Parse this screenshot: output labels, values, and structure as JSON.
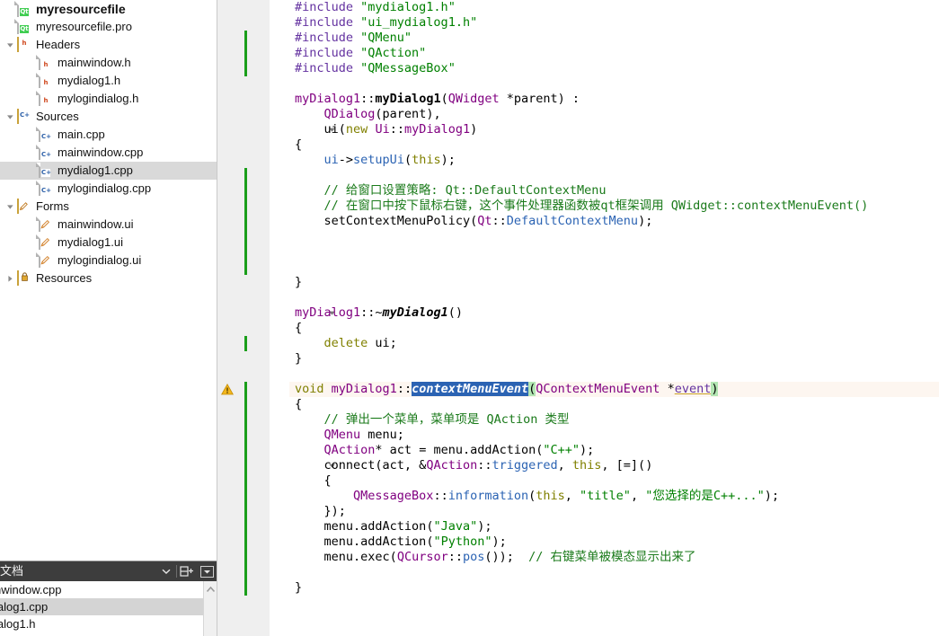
{
  "sidebar": {
    "tree": [
      {
        "depth": 0,
        "label": "myresourcefile",
        "icon": "qt-project-icon",
        "type": "project",
        "twisty": "none",
        "selected": false
      },
      {
        "depth": 1,
        "label": "myresourcefile.pro",
        "icon": "qt-pro-file-icon",
        "type": "profile",
        "twisty": "none",
        "selected": false
      },
      {
        "depth": 1,
        "label": "Headers",
        "icon": "headers-folder-icon",
        "type": "folder-h",
        "twisty": "expanded",
        "selected": false
      },
      {
        "depth": 2,
        "label": "mainwindow.h",
        "icon": "header-file-icon",
        "type": "file-h",
        "twisty": "none",
        "selected": false
      },
      {
        "depth": 2,
        "label": "mydialog1.h",
        "icon": "header-file-icon",
        "type": "file-h",
        "twisty": "none",
        "selected": false
      },
      {
        "depth": 2,
        "label": "mylogindialog.h",
        "icon": "header-file-icon",
        "type": "file-h",
        "twisty": "none",
        "selected": false
      },
      {
        "depth": 1,
        "label": "Sources",
        "icon": "sources-folder-icon",
        "type": "folder-cpp",
        "twisty": "expanded",
        "selected": false
      },
      {
        "depth": 2,
        "label": "main.cpp",
        "icon": "cpp-file-icon",
        "type": "file-cpp",
        "twisty": "none",
        "selected": false
      },
      {
        "depth": 2,
        "label": "mainwindow.cpp",
        "icon": "cpp-file-icon",
        "type": "file-cpp",
        "twisty": "none",
        "selected": false
      },
      {
        "depth": 2,
        "label": "mydialog1.cpp",
        "icon": "cpp-file-icon",
        "type": "file-cpp",
        "twisty": "none",
        "selected": true
      },
      {
        "depth": 2,
        "label": "mylogindialog.cpp",
        "icon": "cpp-file-icon",
        "type": "file-cpp",
        "twisty": "none",
        "selected": false
      },
      {
        "depth": 1,
        "label": "Forms",
        "icon": "forms-folder-icon",
        "type": "folder-ui",
        "twisty": "expanded",
        "selected": false
      },
      {
        "depth": 2,
        "label": "mainwindow.ui",
        "icon": "ui-file-icon",
        "type": "file-ui",
        "twisty": "none",
        "selected": false
      },
      {
        "depth": 2,
        "label": "mydialog1.ui",
        "icon": "ui-file-icon",
        "type": "file-ui",
        "twisty": "none",
        "selected": false
      },
      {
        "depth": 2,
        "label": "mylogindialog.ui",
        "icon": "ui-file-icon",
        "type": "file-ui",
        "twisty": "none",
        "selected": false
      },
      {
        "depth": 1,
        "label": "Resources",
        "icon": "resources-folder-icon",
        "type": "folder-res",
        "twisty": "collapsed",
        "selected": false
      }
    ]
  },
  "doc_dock": {
    "title": "文档",
    "dropdown_icon": "chevron-down-icon",
    "split_icon": "split-pane-icon",
    "close_icon": "dock-menu-icon",
    "items": [
      {
        "label": "nwindow.cpp",
        "selected": false
      },
      {
        "label": "ialog1.cpp",
        "selected": true
      },
      {
        "label": "ialog1.h",
        "selected": false
      }
    ],
    "scroll_up_icon": "scroll-up-icon"
  },
  "editor": {
    "current_line": 26,
    "warning_line": 26,
    "warning_icon": "warning-triangle-icon",
    "total_lines": 40,
    "change_bars": [
      {
        "from": 3,
        "to": 5
      },
      {
        "from": 12,
        "to": 18
      },
      {
        "from": 23,
        "to": 23
      },
      {
        "from": 26,
        "to": 39
      }
    ],
    "fold_markers": [
      9,
      21,
      26,
      31
    ],
    "lines": [
      {
        "n": 1,
        "tokens": [
          {
            "t": "#include ",
            "c": "t-pre"
          },
          {
            "t": "\"mydialog1.h\"",
            "c": "t-str"
          }
        ]
      },
      {
        "n": 2,
        "tokens": [
          {
            "t": "#include ",
            "c": "t-pre"
          },
          {
            "t": "\"ui_mydialog1.h\"",
            "c": "t-str"
          }
        ]
      },
      {
        "n": 3,
        "tokens": [
          {
            "t": "#include ",
            "c": "t-pre"
          },
          {
            "t": "\"QMenu\"",
            "c": "t-str"
          }
        ]
      },
      {
        "n": 4,
        "tokens": [
          {
            "t": "#include ",
            "c": "t-pre"
          },
          {
            "t": "\"QAction\"",
            "c": "t-str"
          }
        ]
      },
      {
        "n": 5,
        "tokens": [
          {
            "t": "#include ",
            "c": "t-pre"
          },
          {
            "t": "\"QMessageBox\"",
            "c": "t-str"
          }
        ]
      },
      {
        "n": 6,
        "tokens": []
      },
      {
        "n": 7,
        "tokens": [
          {
            "t": "myDialog1",
            "c": "t-type"
          },
          {
            "t": "::",
            "c": "t-plain"
          },
          {
            "t": "myDialog1",
            "c": "t-ctor"
          },
          {
            "t": "(",
            "c": "t-plain"
          },
          {
            "t": "QWidget",
            "c": "t-type"
          },
          {
            "t": " *parent) :",
            "c": "t-plain"
          }
        ]
      },
      {
        "n": 8,
        "tokens": [
          {
            "t": "    ",
            "c": "t-plain"
          },
          {
            "t": "QDialog",
            "c": "t-type"
          },
          {
            "t": "(parent),",
            "c": "t-plain"
          }
        ]
      },
      {
        "n": 9,
        "tokens": [
          {
            "t": "    ui(",
            "c": "t-plain"
          },
          {
            "t": "new",
            "c": "t-kw"
          },
          {
            "t": " ",
            "c": "t-plain"
          },
          {
            "t": "Ui",
            "c": "t-type"
          },
          {
            "t": "::",
            "c": "t-plain"
          },
          {
            "t": "myDialog1",
            "c": "t-type"
          },
          {
            "t": ")",
            "c": "t-plain"
          }
        ]
      },
      {
        "n": 10,
        "tokens": [
          {
            "t": "{",
            "c": "t-plain"
          }
        ]
      },
      {
        "n": 11,
        "tokens": [
          {
            "t": "    ",
            "c": "t-plain"
          },
          {
            "t": "ui",
            "c": "t-blue"
          },
          {
            "t": "->",
            "c": "t-plain"
          },
          {
            "t": "setupUi",
            "c": "t-blue"
          },
          {
            "t": "(",
            "c": "t-plain"
          },
          {
            "t": "this",
            "c": "t-kw"
          },
          {
            "t": ");",
            "c": "t-plain"
          }
        ]
      },
      {
        "n": 12,
        "tokens": []
      },
      {
        "n": 13,
        "tokens": [
          {
            "t": "    // 给窗口设置策略: Qt::DefaultContextMenu",
            "c": "t-cmt"
          }
        ]
      },
      {
        "n": 14,
        "tokens": [
          {
            "t": "    // 在窗口中按下鼠标右键，这个事件处理器函数被qt框架调用 QWidget::contextMenuEvent()",
            "c": "t-cmt"
          }
        ]
      },
      {
        "n": 15,
        "tokens": [
          {
            "t": "    ",
            "c": "t-plain"
          },
          {
            "t": "setContextMenuPolicy",
            "c": "t-plain"
          },
          {
            "t": "(",
            "c": "t-plain"
          },
          {
            "t": "Qt",
            "c": "t-type"
          },
          {
            "t": "::",
            "c": "t-plain"
          },
          {
            "t": "DefaultContextMenu",
            "c": "t-blue"
          },
          {
            "t": ");",
            "c": "t-plain"
          }
        ]
      },
      {
        "n": 16,
        "tokens": []
      },
      {
        "n": 17,
        "tokens": []
      },
      {
        "n": 18,
        "tokens": []
      },
      {
        "n": 19,
        "tokens": [
          {
            "t": "}",
            "c": "t-plain"
          }
        ]
      },
      {
        "n": 20,
        "tokens": []
      },
      {
        "n": 21,
        "tokens": [
          {
            "t": "myDialog1",
            "c": "t-type"
          },
          {
            "t": "::~",
            "c": "t-plain"
          },
          {
            "t": "myDialog1",
            "c": "t-dtor"
          },
          {
            "t": "()",
            "c": "t-plain"
          }
        ]
      },
      {
        "n": 22,
        "tokens": [
          {
            "t": "{",
            "c": "t-plain"
          }
        ]
      },
      {
        "n": 23,
        "tokens": [
          {
            "t": "    ",
            "c": "t-plain"
          },
          {
            "t": "delete",
            "c": "t-kw"
          },
          {
            "t": " ui;",
            "c": "t-plain"
          }
        ]
      },
      {
        "n": 24,
        "tokens": [
          {
            "t": "}",
            "c": "t-plain"
          }
        ]
      },
      {
        "n": 25,
        "tokens": []
      },
      {
        "n": 26,
        "tokens": [
          {
            "t": "void",
            "c": "t-kw"
          },
          {
            "t": " ",
            "c": "t-plain"
          },
          {
            "t": "myDialog1",
            "c": "t-type"
          },
          {
            "t": "::",
            "c": "t-plain"
          },
          {
            "t": "contextMenuEvent",
            "c": "sel"
          },
          {
            "t": "(",
            "c": "brmatch"
          },
          {
            "t": "QContextMenuEvent",
            "c": "t-type"
          },
          {
            "t": " *",
            "c": "t-plain"
          },
          {
            "t": "event",
            "c": "t-param"
          },
          {
            "t": ")",
            "c": "brmatch"
          }
        ]
      },
      {
        "n": 27,
        "tokens": [
          {
            "t": "{",
            "c": "t-plain"
          }
        ]
      },
      {
        "n": 28,
        "tokens": [
          {
            "t": "    // 弹出一个菜单，菜单项是 QAction 类型",
            "c": "t-cmt"
          }
        ]
      },
      {
        "n": 29,
        "tokens": [
          {
            "t": "    ",
            "c": "t-plain"
          },
          {
            "t": "QMenu",
            "c": "t-type"
          },
          {
            "t": " menu;",
            "c": "t-plain"
          }
        ]
      },
      {
        "n": 30,
        "tokens": [
          {
            "t": "    ",
            "c": "t-plain"
          },
          {
            "t": "QAction",
            "c": "t-type"
          },
          {
            "t": "* act = menu.",
            "c": "t-plain"
          },
          {
            "t": "addAction",
            "c": "t-plain"
          },
          {
            "t": "(",
            "c": "t-plain"
          },
          {
            "t": "\"C++\"",
            "c": "t-str"
          },
          {
            "t": ");",
            "c": "t-plain"
          }
        ]
      },
      {
        "n": 31,
        "tokens": [
          {
            "t": "    connect(act, &",
            "c": "t-plain"
          },
          {
            "t": "QAction",
            "c": "t-type"
          },
          {
            "t": "::",
            "c": "t-plain"
          },
          {
            "t": "triggered",
            "c": "t-blue"
          },
          {
            "t": ", ",
            "c": "t-plain"
          },
          {
            "t": "this",
            "c": "t-kw"
          },
          {
            "t": ", [=]()",
            "c": "t-plain"
          }
        ]
      },
      {
        "n": 32,
        "tokens": [
          {
            "t": "    {",
            "c": "t-plain"
          }
        ]
      },
      {
        "n": 33,
        "tokens": [
          {
            "t": "        ",
            "c": "t-plain"
          },
          {
            "t": "QMessageBox",
            "c": "t-type"
          },
          {
            "t": "::",
            "c": "t-plain"
          },
          {
            "t": "information",
            "c": "t-blue"
          },
          {
            "t": "(",
            "c": "t-plain"
          },
          {
            "t": "this",
            "c": "t-kw"
          },
          {
            "t": ", ",
            "c": "t-plain"
          },
          {
            "t": "\"title\"",
            "c": "t-str"
          },
          {
            "t": ", ",
            "c": "t-plain"
          },
          {
            "t": "\"您选择的是C++...\"",
            "c": "t-str"
          },
          {
            "t": ");",
            "c": "t-plain"
          }
        ]
      },
      {
        "n": 34,
        "tokens": [
          {
            "t": "    });",
            "c": "t-plain"
          }
        ]
      },
      {
        "n": 35,
        "tokens": [
          {
            "t": "    menu.",
            "c": "t-plain"
          },
          {
            "t": "addAction",
            "c": "t-plain"
          },
          {
            "t": "(",
            "c": "t-plain"
          },
          {
            "t": "\"Java\"",
            "c": "t-str"
          },
          {
            "t": ");",
            "c": "t-plain"
          }
        ]
      },
      {
        "n": 36,
        "tokens": [
          {
            "t": "    menu.",
            "c": "t-plain"
          },
          {
            "t": "addAction",
            "c": "t-plain"
          },
          {
            "t": "(",
            "c": "t-plain"
          },
          {
            "t": "\"Python\"",
            "c": "t-str"
          },
          {
            "t": ");",
            "c": "t-plain"
          }
        ]
      },
      {
        "n": 37,
        "tokens": [
          {
            "t": "    menu.",
            "c": "t-plain"
          },
          {
            "t": "exec",
            "c": "t-plain"
          },
          {
            "t": "(",
            "c": "t-plain"
          },
          {
            "t": "QCursor",
            "c": "t-type"
          },
          {
            "t": "::",
            "c": "t-plain"
          },
          {
            "t": "pos",
            "c": "t-blue"
          },
          {
            "t": "());  ",
            "c": "t-plain"
          },
          {
            "t": "// 右键菜单被模态显示出来了",
            "c": "t-cmt"
          }
        ]
      },
      {
        "n": 38,
        "tokens": []
      },
      {
        "n": 39,
        "tokens": [
          {
            "t": "}",
            "c": "t-plain"
          }
        ]
      },
      {
        "n": 40,
        "tokens": []
      }
    ]
  },
  "colors": {
    "selection": "#2b63b3",
    "change_marker": "#1a9e1a",
    "current_line": "#fdf6f0",
    "bracket_match": "#b3e6b3",
    "dock_header": "#3d3d3d",
    "tree_selected": "#d9d9d9"
  }
}
